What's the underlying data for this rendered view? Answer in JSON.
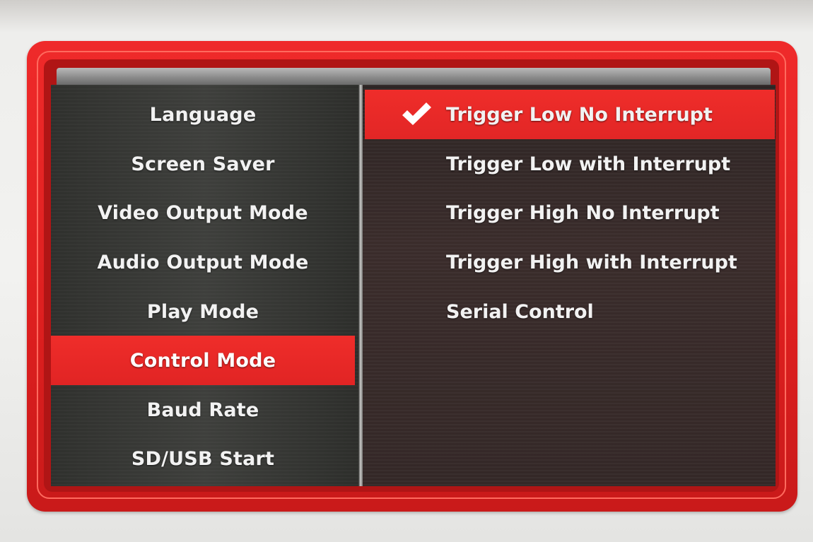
{
  "menu": {
    "categories": [
      {
        "label": "Language"
      },
      {
        "label": "Screen Saver"
      },
      {
        "label": "Video Output Mode"
      },
      {
        "label": "Audio Output Mode"
      },
      {
        "label": "Play Mode"
      },
      {
        "label": "Control Mode"
      },
      {
        "label": "Baud Rate"
      },
      {
        "label": "SD/USB Start"
      }
    ],
    "selected_category": "Control Mode"
  },
  "options": {
    "items": [
      {
        "label": "Trigger Low No Interrupt",
        "checked": true
      },
      {
        "label": "Trigger Low with Interrupt",
        "checked": false
      },
      {
        "label": "Trigger High No Interrupt",
        "checked": false
      },
      {
        "label": "Trigger High with Interrupt",
        "checked": false
      },
      {
        "label": "Serial Control",
        "checked": false
      }
    ],
    "checked_icon": "checkmark-icon"
  },
  "colors": {
    "accent_red": "#e12424",
    "frame_red": "#dd1f1f",
    "text": "#f2f2f2"
  }
}
